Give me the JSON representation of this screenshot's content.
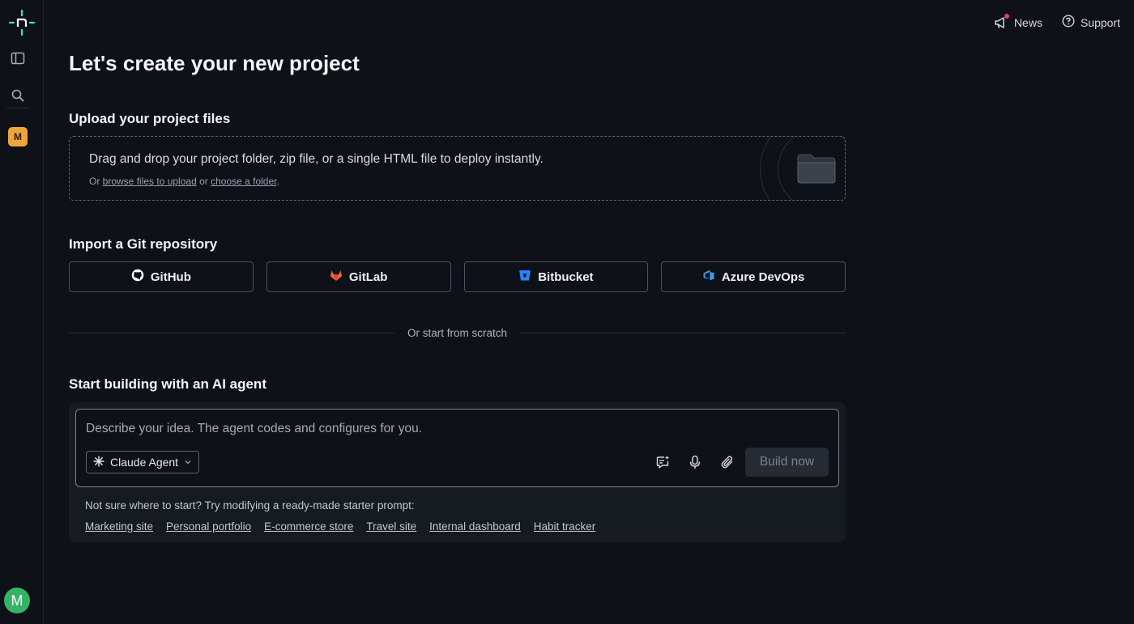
{
  "sidebar": {
    "team_initial": "M",
    "user_initial": "M",
    "icons": [
      "netlify-logo-icon",
      "sidebar-panel-icon",
      "search-icon"
    ]
  },
  "topnav": {
    "news_label": "News",
    "support_label": "Support"
  },
  "page": {
    "title": "Let's create your new project"
  },
  "upload": {
    "heading": "Upload your project files",
    "main_text": "Drag and drop your project folder, zip file, or a single HTML file to deploy instantly.",
    "sub_prefix": "Or ",
    "browse_link": "browse files to upload",
    "sub_middle": " or ",
    "folder_link": "choose a folder",
    "sub_suffix": "."
  },
  "git": {
    "heading": "Import a Git repository",
    "providers": [
      {
        "label": "GitHub",
        "icon": "github-icon"
      },
      {
        "label": "GitLab",
        "icon": "gitlab-icon"
      },
      {
        "label": "Bitbucket",
        "icon": "bitbucket-icon"
      },
      {
        "label": "Azure DevOps",
        "icon": "azure-devops-icon"
      }
    ]
  },
  "divider_text": "Or start from scratch",
  "ai": {
    "heading": "Start building with an AI agent",
    "placeholder": "Describe your idea. The agent codes and configures for you.",
    "agent_selected": "Claude Agent",
    "build_label": "Build now",
    "starter_label": "Not sure where to start? Try modifying a ready-made starter prompt:",
    "starters": [
      "Marketing site",
      "Personal portfolio",
      "E-commerce store",
      "Travel site",
      "Internal dashboard",
      "Habit tracker"
    ]
  },
  "colors": {
    "background": "#0e1117",
    "accent_gitlab": "#fc6d26",
    "accent_bitbucket": "#2684ff",
    "accent_azure": "#3b9cf0",
    "team_badge": "#f0a53c",
    "user_avatar": "#35b365",
    "logo_teal": "#32e6e2"
  }
}
